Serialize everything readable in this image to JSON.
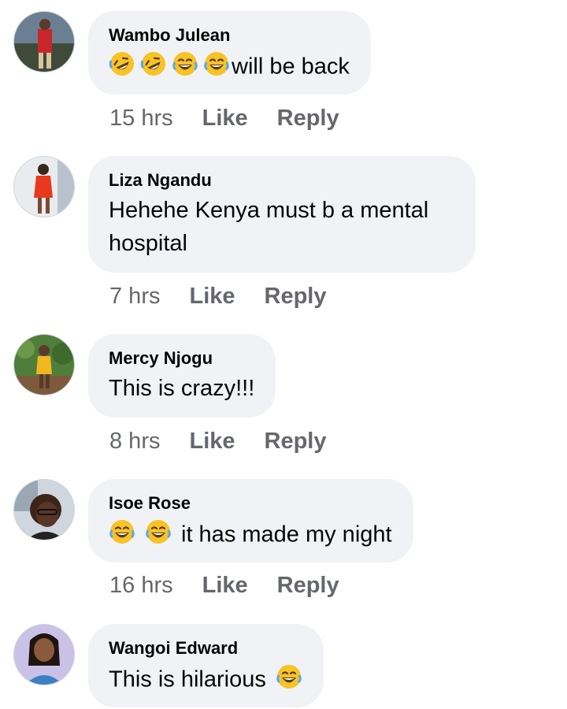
{
  "comments": [
    {
      "author": "Wambo Julean",
      "text": "will be back",
      "emojis": [
        "rolling-laughing",
        "rolling-laughing",
        "tears-of-joy",
        "tears-of-joy"
      ],
      "time": "15 hrs",
      "like": "Like",
      "reply": "Reply"
    },
    {
      "author": "Liza Ngandu",
      "text": "Hehehe Kenya must b a mental hospital",
      "emojis": [],
      "time": "7 hrs",
      "like": "Like",
      "reply": "Reply"
    },
    {
      "author": "Mercy Njogu",
      "text": "This is crazy!!!",
      "emojis": [],
      "time": "8 hrs",
      "like": "Like",
      "reply": "Reply"
    },
    {
      "author": "Isoe Rose",
      "text": "it has made my night",
      "emojis": [
        "tears-of-joy",
        "tears-of-joy"
      ],
      "time": "16 hrs",
      "like": "Like",
      "reply": "Reply"
    },
    {
      "author": "Wangoi Edward",
      "text": "This is hilarious",
      "emojis": [
        "tears-of-joy"
      ],
      "time": "",
      "like": "",
      "reply": ""
    }
  ],
  "colors": {
    "bubble": "#f0f2f5",
    "meta_text": "#65676b",
    "name_text": "#050505",
    "emoji_yellow": "#f7c325"
  }
}
